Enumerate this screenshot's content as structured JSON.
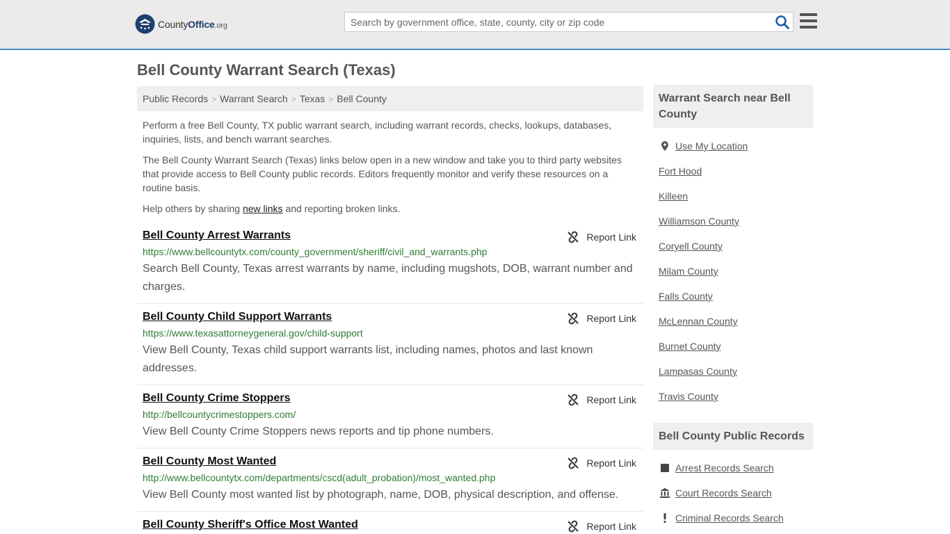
{
  "header": {
    "logo_brand": "County",
    "logo_brand_bold": "Office",
    "logo_suffix": ".org",
    "search_placeholder": "Search by government office, state, county, city or zip code",
    "icons": {
      "search": "search-icon",
      "menu": "hamburger-menu-icon",
      "logo": "county-office-seal-icon"
    }
  },
  "page_title": "Bell County Warrant Search (Texas)",
  "breadcrumb": [
    {
      "label": "Public Records"
    },
    {
      "label": "Warrant Search"
    },
    {
      "label": "Texas"
    },
    {
      "label": "Bell County"
    }
  ],
  "breadcrumb_separator": ">",
  "intro": {
    "p1": "Perform a free Bell County, TX public warrant search, including warrant records, checks, lookups, databases, inquiries, lists, and bench warrant searches.",
    "p2": "The Bell County Warrant Search (Texas) links below open in a new window and take you to third party websites that provide access to Bell County public records. Editors frequently monitor and verify these resources on a routine basis.",
    "p3_before": "Help others by sharing ",
    "p3_link": "new links",
    "p3_after": " and reporting broken links."
  },
  "report_label": "Report Link",
  "listings": [
    {
      "name": "Bell County Arrest Warrants",
      "url": "https://www.bellcountytx.com/county_government/sheriff/civil_and_warrants.php",
      "desc": "Search Bell County, Texas arrest warrants by name, including mugshots, DOB, warrant number and charges."
    },
    {
      "name": "Bell County Child Support Warrants",
      "url": "https://www.texasattorneygeneral.gov/child-support",
      "desc": "View Bell County, Texas child support warrants list, including names, photos and last known addresses."
    },
    {
      "name": "Bell County Crime Stoppers",
      "url": "http://bellcountycrimestoppers.com/",
      "desc": "View Bell County Crime Stoppers news reports and tip phone numbers."
    },
    {
      "name": "Bell County Most Wanted",
      "url": "http://www.bellcountytx.com/departments/cscd(adult_probation)/most_wanted.php",
      "desc": "View Bell County most wanted list by photograph, name, DOB, physical description, and offense."
    },
    {
      "name": "Bell County Sheriff's Office Most Wanted",
      "url": "",
      "desc": ""
    }
  ],
  "sidebar": {
    "near_title": "Warrant Search near Bell County",
    "use_location": "Use My Location",
    "near_links": [
      "Fort Hood",
      "Killeen",
      "Williamson County",
      "Coryell County",
      "Milam County",
      "Falls County",
      "McLennan County",
      "Burnet County",
      "Lampasas County",
      "Travis County"
    ],
    "records_title": "Bell County Public Records",
    "records_links": [
      {
        "label": "Arrest Records Search",
        "icon": "square-icon"
      },
      {
        "label": "Court Records Search",
        "icon": "courthouse-icon"
      },
      {
        "label": "Criminal Records Search",
        "icon": "exclamation-icon"
      }
    ]
  },
  "colors": {
    "accent_border": "#4a89c8",
    "url_green": "#2e7d32",
    "search_icon": "#1e5fa8",
    "logo_navy": "#1e3f6e"
  }
}
